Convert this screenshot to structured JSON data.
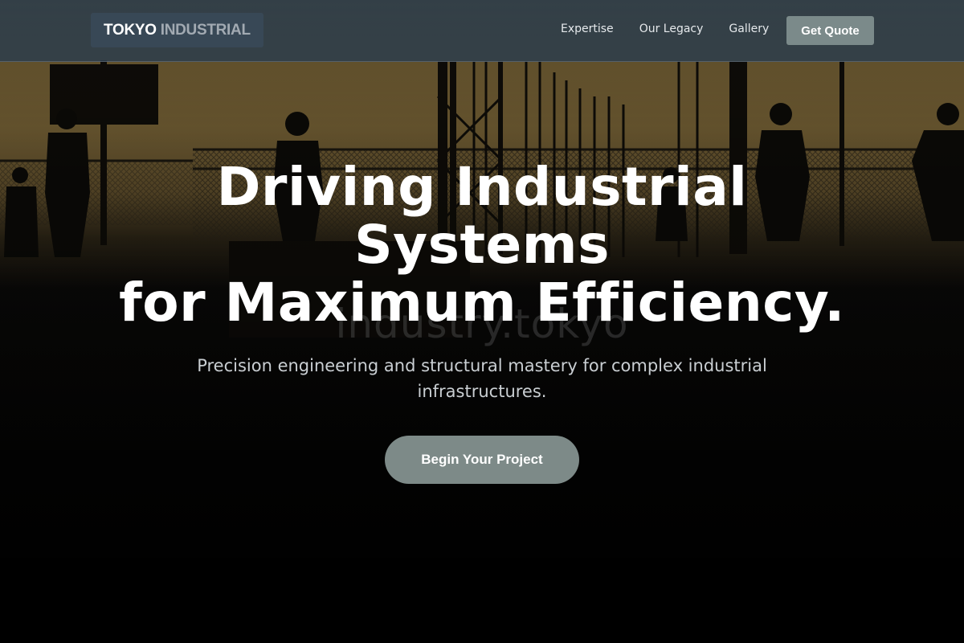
{
  "navbar": {
    "brand_primary": "TOKYO",
    "brand_secondary": "INDUSTRIAL",
    "links": [
      {
        "label": "Expertise"
      },
      {
        "label": "Our Legacy"
      },
      {
        "label": "Gallery"
      }
    ],
    "quote_label": "Get Quote"
  },
  "hero": {
    "headline_line1": "Driving Industrial",
    "headline_line2": "Systems",
    "headline_line3": "for Maximum Efficiency.",
    "background_text": "industry.tokyo",
    "subtitle": "Precision engineering and structural mastery for complex industrial infrastructures.",
    "cta_label": "Begin Your Project"
  },
  "colors": {
    "navbar_bg": "#2e3d4b",
    "accent_button": "#7b8a8a",
    "hero_sky": "#6e5a2e",
    "hero_dark": "#000000"
  }
}
